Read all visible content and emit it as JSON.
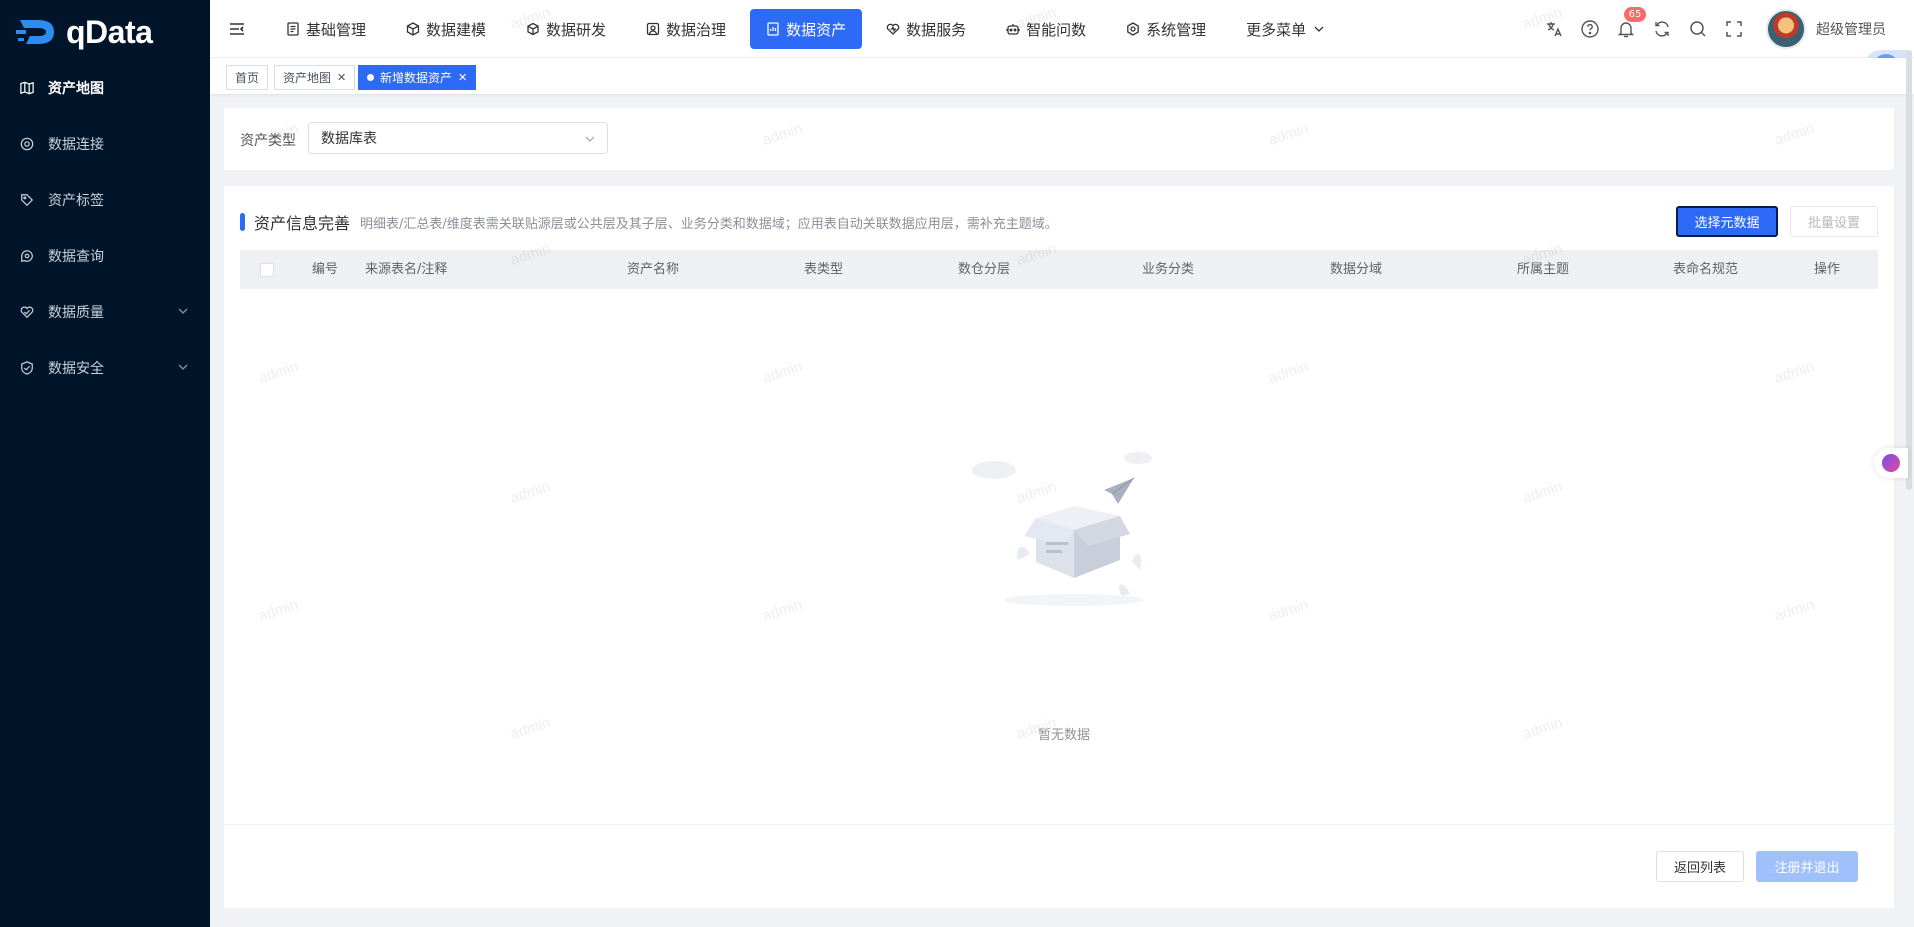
{
  "brand": {
    "name": "qData"
  },
  "sidebar": {
    "items": [
      {
        "label": "资产地图",
        "icon": "map-icon",
        "active": true
      },
      {
        "label": "数据连接",
        "icon": "link-icon"
      },
      {
        "label": "资产标签",
        "icon": "tag-icon"
      },
      {
        "label": "数据查询",
        "icon": "query-icon"
      },
      {
        "label": "数据质量",
        "icon": "quality-icon",
        "has_children": true
      },
      {
        "label": "数据安全",
        "icon": "shield-icon",
        "has_children": true
      }
    ]
  },
  "topnav": {
    "items": [
      {
        "label": "基础管理",
        "icon": "document-icon"
      },
      {
        "label": "数据建模",
        "icon": "cube-icon"
      },
      {
        "label": "数据研发",
        "icon": "box-icon"
      },
      {
        "label": "数据治理",
        "icon": "governance-icon"
      },
      {
        "label": "数据资产",
        "icon": "asset-icon",
        "active": true
      },
      {
        "label": "数据服务",
        "icon": "heart-icon"
      },
      {
        "label": "智能问数",
        "icon": "robot-icon"
      },
      {
        "label": "系统管理",
        "icon": "settings-icon"
      },
      {
        "label": "更多菜单",
        "icon": "chevron-down-icon"
      }
    ],
    "notification_count": "65",
    "user_name": "超级管理员",
    "translate_label": "译"
  },
  "tags": [
    {
      "label": "首页"
    },
    {
      "label": "资产地图",
      "closable": true
    },
    {
      "label": "新增数据资产",
      "closable": true,
      "active": true
    }
  ],
  "filter": {
    "label": "资产类型",
    "value": "数据库表"
  },
  "section": {
    "title": "资产信息完善",
    "description": "明细表/汇总表/维度表需关联贴源层或公共层及其子层、业务分类和数据域；应用表自动关联数据应用层，需补充主题域。",
    "select_button": "选择元数据",
    "batch_button": "批量设置"
  },
  "table": {
    "columns": [
      "编号",
      "来源表名/注释",
      "资产名称",
      "表类型",
      "数仓分层",
      "业务分类",
      "数据分域",
      "所属主题",
      "表命名规范",
      "操作"
    ],
    "rows": [],
    "empty_text": "暂无数据"
  },
  "footer": {
    "back_button": "返回列表",
    "submit_button": "注册并退出"
  },
  "watermark": "admin",
  "colors": {
    "sidebar_bg": "#001529",
    "primary": "#2d6af5",
    "primary_disabled": "#a0c0fb"
  }
}
